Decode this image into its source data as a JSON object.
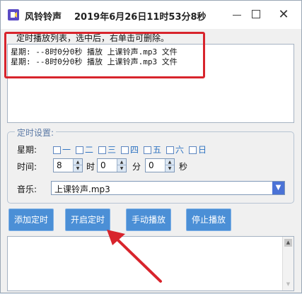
{
  "window": {
    "app_name": "风铃铃声",
    "title_datetime": "2019年6月26日11时53分8秒",
    "controls": {
      "minimize": "—",
      "maximize": "□",
      "close": "✕"
    },
    "icons": {
      "app": "app-icon",
      "minimize": "minimize-icon",
      "maximize": "maximize-icon",
      "close": "close-icon"
    }
  },
  "schedule_list": {
    "header": "定时播放列表，选中后，右单击可删除。",
    "items": [
      "星期: --8时0分0秒 播放 上课铃声.mp3 文件",
      "星期: --8时0分0秒 播放 上课铃声.mp3 文件"
    ]
  },
  "settings": {
    "group_title": "定时设置:",
    "weekday_label": "星期:",
    "weekdays": [
      "一",
      "二",
      "三",
      "四",
      "五",
      "六",
      "日"
    ],
    "time_label": "时间:",
    "hour_value": "8",
    "hour_unit": "时",
    "minute_value": "0",
    "minute_unit": "分",
    "second_value": "0",
    "second_unit": "秒",
    "music_label": "音乐:",
    "music_selected": "上课铃声.mp3",
    "spin_up_glyph": "▲",
    "spin_down_glyph": "▼",
    "dropdown_glyph": "▼"
  },
  "buttons": {
    "add": "添加定时",
    "start": "开启定时",
    "manual_play": "手动播放",
    "stop_play": "停止播放"
  },
  "log": {
    "scroll_up_glyph": "▲",
    "scroll_down_glyph": "▼"
  },
  "colors": {
    "button_bg": "#4b8fd6",
    "highlight_red": "#d8242c",
    "dropdown_blue": "#4a72d6",
    "weekday_blue": "#2e73c2"
  }
}
